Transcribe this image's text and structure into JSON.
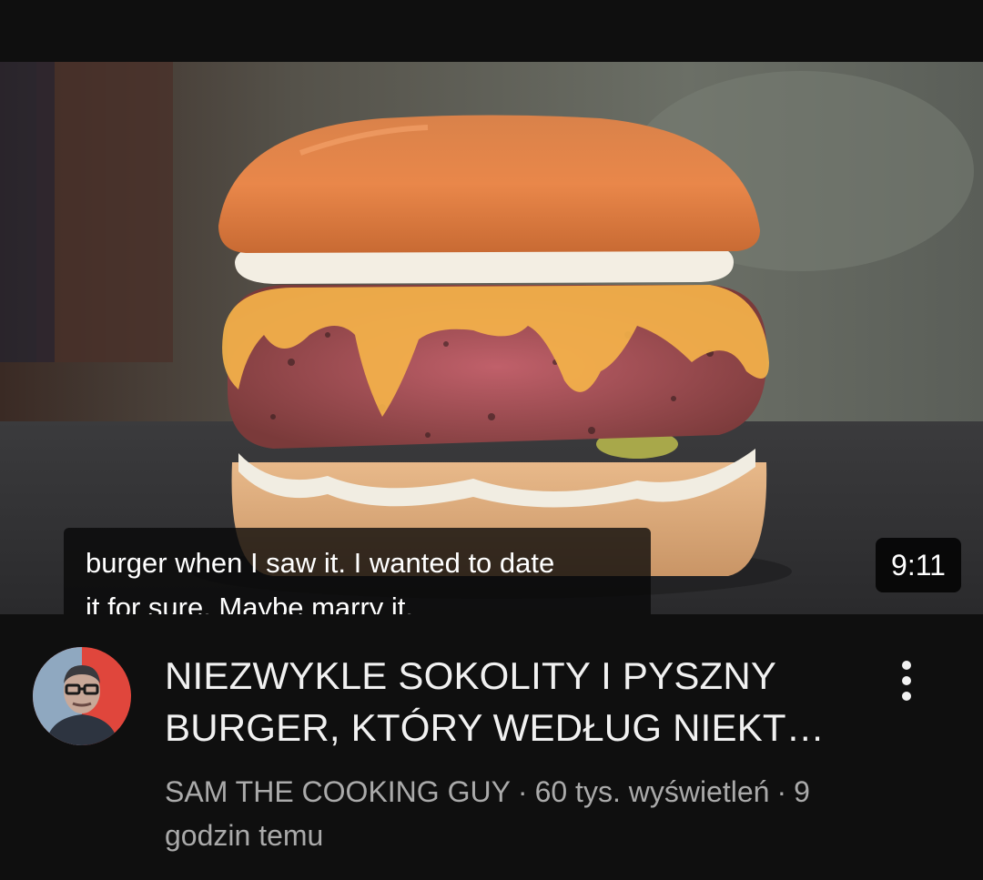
{
  "video": {
    "caption_line1": "burger when I saw it. I wanted to date",
    "caption_line2": "it for sure. Maybe marry it.",
    "duration": "9:11",
    "title_line1": "NIEZWYKLE SOKOLITY I PYSZNY",
    "title_line2": "BURGER, KTÓRY WEDŁUG NIEKT…",
    "channel": "SAM THE COOKING GUY",
    "separator": "·",
    "views": "60 tys. wyświetleń",
    "age_part1": "9",
    "age_part2": "godzin temu"
  },
  "icons": {
    "menu": "more-vert-icon"
  },
  "colors": {
    "background": "#0f0f0f",
    "title": "#f1f1f1",
    "meta": "#aaaaaa",
    "avatar_bg": "#e0463c"
  }
}
